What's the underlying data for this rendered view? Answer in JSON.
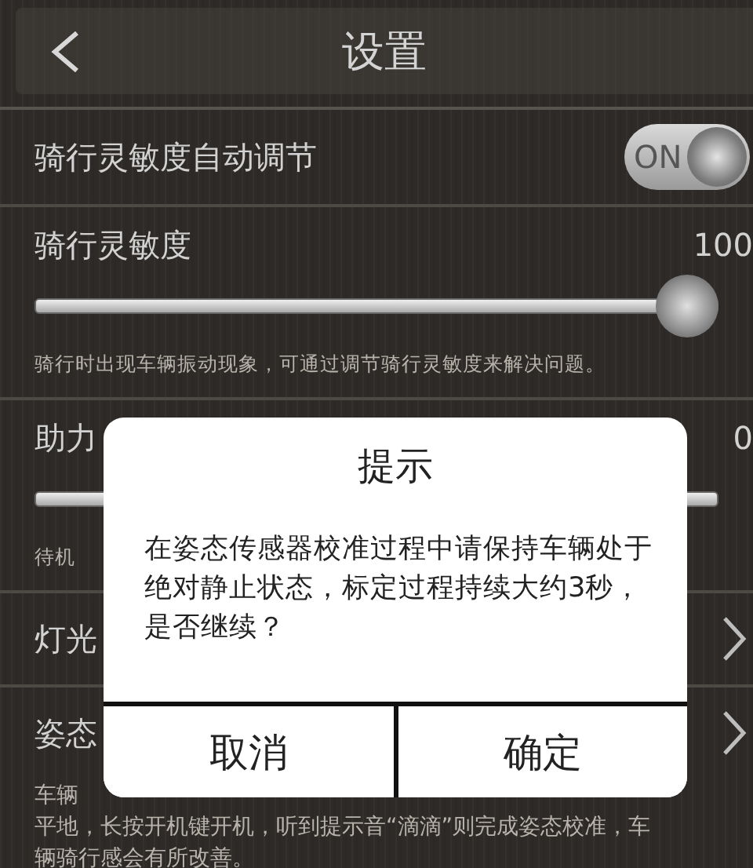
{
  "header": {
    "title": "设置"
  },
  "items": [
    {
      "kind": "toggle",
      "label": "骑行灵敏度自动调节",
      "on": true,
      "toggle_text": "ON"
    },
    {
      "kind": "slider",
      "label": "骑行灵敏度",
      "value": "100",
      "level": 1,
      "hint": "骑行时出现车辆振动现象，可通过调节骑行灵敏度来解决问题。"
    },
    {
      "kind": "slider",
      "label": "助力",
      "value": "0",
      "hint": "待机"
    },
    {
      "kind": "link",
      "label": "灯光"
    },
    {
      "kind": "link",
      "label": "姿态",
      "note_lines": [
        "车辆",
        "平地，长按开机键开机，听到提示音“滴滴”则完成姿态校准，车",
        "辆骑行感会有所改善。"
      ]
    }
  ],
  "dialog": {
    "title": "提示",
    "message": "在姿态传感器校准过程中请保持车辆处于绝对静止状态，标定过程持续大约3秒，是否继续？",
    "buttons": [
      "取消",
      "确定"
    ]
  }
}
